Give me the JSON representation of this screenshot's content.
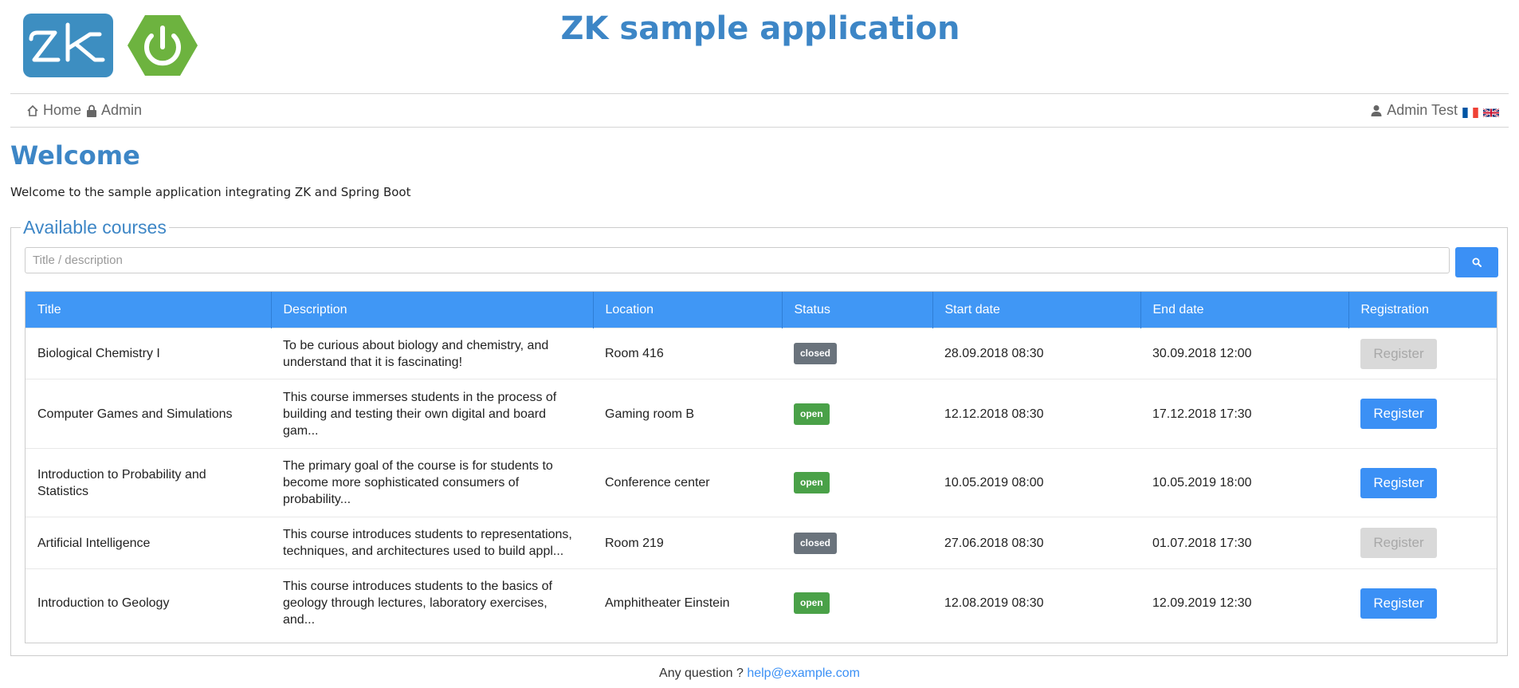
{
  "header": {
    "title": "ZK sample application",
    "logos": [
      "zk-logo",
      "spring-boot-logo"
    ],
    "zk_logo_color": "#3d8ec1",
    "spring_logo_color": "#6db33f",
    "title_color": "#3d86c6"
  },
  "nav": {
    "home_label": "Home",
    "admin_label": "Admin",
    "user_label": "Admin Test",
    "icons": [
      "home-icon",
      "lock-icon",
      "user-icon",
      "flag-fr-icon",
      "flag-uk-icon"
    ]
  },
  "welcome": {
    "heading": "Welcome",
    "text": "Welcome to the sample application integrating ZK and Spring Boot"
  },
  "courses": {
    "legend": "Available courses",
    "search_placeholder": "Title / description",
    "search_value": "",
    "search_button_icon": "search-icon",
    "columns": [
      "Title",
      "Description",
      "Location",
      "Status",
      "Start date",
      "End date",
      "Registration"
    ],
    "accent_color": "#4097f5",
    "rows": [
      {
        "title": "Biological Chemistry I",
        "description": "To be curious about biology and chemistry, and understand that it is fascinating!",
        "location": "Room 416",
        "status": "closed",
        "start": "28.09.2018 08:30",
        "end": "30.09.2018 12:00",
        "register_label": "Register",
        "register_enabled": false
      },
      {
        "title": "Computer Games and Simulations",
        "description": "This course immerses students in the process of building and testing their own digital and board gam...",
        "location": "Gaming room B",
        "status": "open",
        "start": "12.12.2018 08:30",
        "end": "17.12.2018 17:30",
        "register_label": "Register",
        "register_enabled": true
      },
      {
        "title": "Introduction to Probability and Statistics",
        "description": "The primary goal of the course is for students to become more sophisticated consumers of probability...",
        "location": "Conference center",
        "status": "open",
        "start": "10.05.2019 08:00",
        "end": "10.05.2019 18:00",
        "register_label": "Register",
        "register_enabled": true
      },
      {
        "title": "Artificial Intelligence",
        "description": "This course introduces students to representations, techniques, and architectures used to build appl...",
        "location": "Room 219",
        "status": "closed",
        "start": "27.06.2018 08:30",
        "end": "01.07.2018 17:30",
        "register_label": "Register",
        "register_enabled": false
      },
      {
        "title": "Introduction to Geology",
        "description": "This course introduces students to the basics of geology through lectures, laboratory exercises, and...",
        "location": "Amphitheater Einstein",
        "status": "open",
        "start": "12.08.2019 08:30",
        "end": "12.09.2019 12:30",
        "register_label": "Register",
        "register_enabled": true
      }
    ]
  },
  "footer": {
    "question": "Any question ?",
    "email": "help@example.com"
  }
}
